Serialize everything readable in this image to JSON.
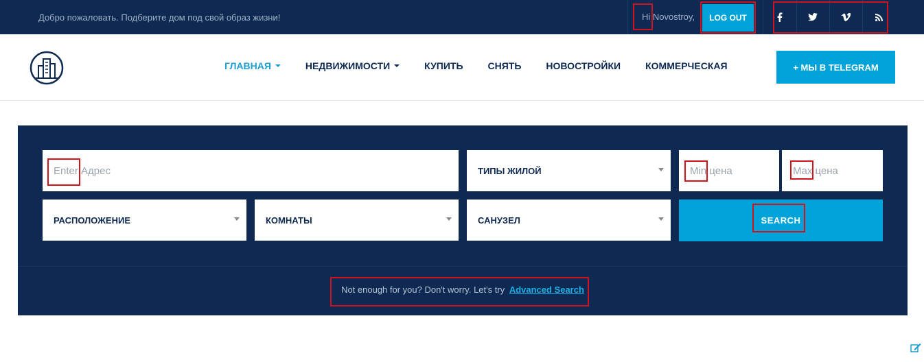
{
  "topbar": {
    "welcome": "Добро пожаловать. Подберите дом под свой образ жизни!",
    "greeting": "Hi Novostroy,",
    "logout_label": "LOG OUT",
    "social": [
      {
        "icon": "facebook-icon"
      },
      {
        "icon": "twitter-icon"
      },
      {
        "icon": "vimeo-icon"
      },
      {
        "icon": "rss-icon"
      }
    ]
  },
  "header": {
    "logo_icon": "building-logo-icon",
    "nav": [
      {
        "label": "ГЛАВНАЯ",
        "active": true,
        "dropdown": true
      },
      {
        "label": "НЕДВИЖИМОСТИ",
        "active": false,
        "dropdown": true
      },
      {
        "label": "КУПИТЬ",
        "active": false,
        "dropdown": false
      },
      {
        "label": "СНЯТЬ",
        "active": false,
        "dropdown": false
      },
      {
        "label": "НОВОСТРОЙКИ",
        "active": false,
        "dropdown": false
      },
      {
        "label": "КОММЕРЧЕСКАЯ",
        "active": false,
        "dropdown": false
      }
    ],
    "telegram_label": "+ МЫ В TELEGRAM"
  },
  "search": {
    "address_placeholder": "Enter Адрес",
    "type_select": "ТИПЫ ЖИЛОЙ",
    "min_price_placeholder": "Min цена",
    "max_price_placeholder": "Max цена",
    "location_select": "РАСПОЛОЖЕНИЕ",
    "rooms_select": "КОМНАТЫ",
    "bath_select": "САНУЗЕЛ",
    "search_label": "SEARCH",
    "advanced_text": "Not enough for you? Don't worry. Let's try",
    "advanced_link": "Advanced Search"
  },
  "colors": {
    "navy": "#0f2a52",
    "accent": "#00a3d9",
    "annotation": "#d0121b"
  }
}
